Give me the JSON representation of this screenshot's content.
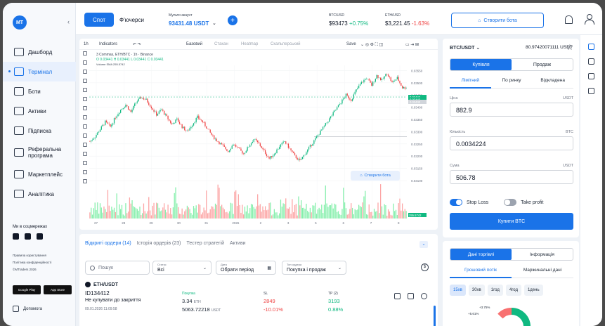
{
  "sidebar": {
    "logo": "MT",
    "items": [
      {
        "label": "Дашборд"
      },
      {
        "label": "Термінал"
      },
      {
        "label": "Боти"
      },
      {
        "label": "Активи"
      },
      {
        "label": "Підписка"
      },
      {
        "label": "Реферальна програма"
      },
      {
        "label": "Маркетплейс"
      },
      {
        "label": "Аналітика"
      }
    ],
    "social_title": "Ми в соцмережах",
    "legal": [
      "Правила користування",
      "Політика конфіденційності",
      "©MTraders 2026"
    ],
    "google_play": "Google Play",
    "app_store": "App Store",
    "help": "Допомога"
  },
  "topbar": {
    "spot": "Спот",
    "futures": "Ф'ючерси",
    "account_label": "Мульти акаунт",
    "account_value": "93431.48 USDT",
    "plus": "+",
    "tickers": [
      {
        "symbol": "BTC/USD",
        "price": "$93473",
        "change": "+0.75%"
      },
      {
        "symbol": "ETH/USD",
        "price": "$3,221.45",
        "change": "-1.63%"
      }
    ],
    "create_bot": "Створити бота"
  },
  "chart": {
    "toolbar": {
      "interval": "1h",
      "indicators": "Indicators",
      "tabs": [
        "Базовий",
        "Стакан",
        "Heatmap",
        "Скальперський"
      ],
      "save": "Save"
    },
    "info": "3 Commas, ETH/BTC · 1h · Binance",
    "ohlc": "O 0.03441  H 0.03441  L 0.03441  C 0.03441",
    "volume": "Volume SMA  255.5742",
    "create_bot_pill": "Створити бота"
  },
  "chart_data": {
    "type": "candlestick",
    "y_ticks": [
      "0.03550",
      "0.03500",
      "0.03450",
      "0.03400",
      "0.03350",
      "0.03300",
      "0.03250",
      "0.03200",
      "0.03150",
      "0.03100"
    ],
    "y_range": [
      0.031,
      0.0356
    ],
    "x_ticks": [
      "27",
      "28",
      "29",
      "30",
      "31",
      "2026",
      "2",
      "3",
      "5",
      "6",
      "7",
      "8"
    ],
    "markers": [
      "0.03442",
      "0.03440",
      "0.03430",
      "255.5742"
    ],
    "close": [
      0.0326,
      0.0328,
      0.0331,
      0.0334,
      0.0332,
      0.0336,
      0.0339,
      0.0341,
      0.0338,
      0.0342,
      0.0344,
      0.0343,
      0.034,
      0.0337,
      0.0339,
      0.0336,
      0.0333,
      0.0335,
      0.0332,
      0.033,
      0.0333,
      0.0336,
      0.0334,
      0.0331,
      0.0328,
      0.0326,
      0.0324,
      0.0322,
      0.0325,
      0.0323,
      0.0321,
      0.0324,
      0.0327,
      0.0325,
      0.0322,
      0.0319,
      0.0321,
      0.0324,
      0.0326,
      0.0323,
      0.032,
      0.0318,
      0.0321,
      0.0324,
      0.0327,
      0.033,
      0.0333,
      0.0336,
      0.0339,
      0.0342,
      0.0345,
      0.0343,
      0.0347,
      0.035,
      0.0352,
      0.0349,
      0.0353,
      0.0351,
      0.0354,
      0.035,
      0.0352,
      0.0348
    ]
  },
  "orders": {
    "tabs": [
      "Відкриті ордери (14)",
      "Історія ордерів (23)",
      "Тестер стратегій",
      "Активи"
    ],
    "search": "Пошук",
    "filters": [
      {
        "label": "Статус",
        "value": "Всі"
      },
      {
        "label": "Дата",
        "value": "Обрати період"
      },
      {
        "label": "Тип ордера",
        "value": "Покупка і продаж"
      }
    ],
    "pair": "ETH/USDT",
    "id": "ID134412",
    "note": "Не купувати до закриття",
    "date": "09.01.2026 11:09:58",
    "col_buy": "Покупка",
    "col_sl": "SL",
    "col_tp": "TP (2)",
    "buy_value": "3.34",
    "buy_unit": "ETH",
    "buy_total": "5063.72218",
    "buy_total_unit": "USDT",
    "sl_value": "2849",
    "sl_pct": "-10.01%",
    "tp_value": "3193",
    "tp_pct": "0.88%"
  },
  "order_form": {
    "pair": "BTC/USDT",
    "price_display": "80.97420071111 USDT",
    "buy": "Купівля",
    "sell": "Продаж",
    "types": [
      "Лімітний",
      "По ринку",
      "Відкладена"
    ],
    "price_label": "Ціна",
    "price_unit": "USDT",
    "price_value": "882.9",
    "qty_label": "Кількість",
    "qty_unit": "BTC",
    "qty_value": "0.0034224",
    "sum_label": "Сума",
    "sum_unit": "USDT",
    "sum_value": "506.78",
    "stop_loss": "Stop Loss",
    "take_profit": "Take profit",
    "submit": "Купити BTC"
  },
  "market_data": {
    "tabs": [
      "Дані торгівлі",
      "Інформація"
    ],
    "sub_tabs": [
      "Грошовий потік",
      "Маржинальні дані"
    ],
    "timeframes": [
      "15хв",
      "30хв",
      "1год",
      "4год",
      "1день"
    ],
    "labels": [
      "+3.75%",
      "+5.61%"
    ]
  },
  "colors": {
    "accent": "#1a73e8",
    "up": "#10b981",
    "down": "#ef4444"
  }
}
